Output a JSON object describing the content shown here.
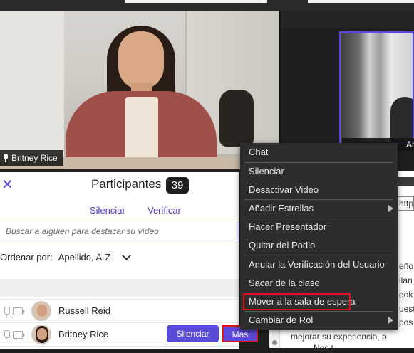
{
  "main_video": {
    "participant_name": "Britney Rice"
  },
  "side_video": {
    "participant_name_partial": "An"
  },
  "panel": {
    "title": "Participantes",
    "count": "39",
    "actions": {
      "mute": "Silenciar",
      "verify": "Verificar"
    },
    "search_placeholder": "Buscar a alguien para destacar su vídeo",
    "sort_label": "Ordenar por:",
    "sort_value": "Apellido, A-Z",
    "participants": [
      {
        "name": "Russell Reid"
      },
      {
        "name": "Britney Rice",
        "mute_label": "Silenciar",
        "more_label": "Mas"
      }
    ]
  },
  "context_menu": {
    "items": [
      "Chat",
      "Silenciar",
      "Desactivar Video",
      "Añadir Estrellas",
      "Hacer Presentador",
      "Quitar del Podio",
      "Anular la Verificación del Usuario",
      "Sacar de la clase",
      "Mover a la sala de espera",
      "Cambiar de Rol"
    ]
  },
  "document": {
    "url_fragment": "http",
    "lines": [
      "eño",
      "ilan",
      "ook",
      "uest",
      "pos",
      "mejorar su experiencia, p",
      "Nos t"
    ]
  },
  "colors": {
    "accent": "#5a4bd6",
    "highlight": "#e0101e",
    "menu_bg": "#2d2d2d"
  }
}
